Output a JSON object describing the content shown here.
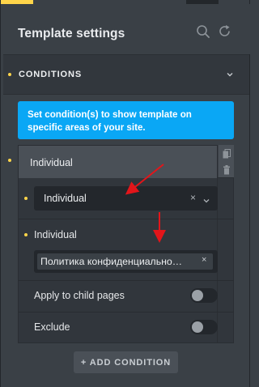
{
  "header": {
    "title": "Template settings",
    "search_icon": "search-icon",
    "refresh_icon": "refresh-icon"
  },
  "section": {
    "title": "CONDITIONS",
    "chevron_icon": "chevron-down-icon"
  },
  "info": {
    "text": "Set condition(s) to show template on specific areas of your site."
  },
  "condition": {
    "header_label": "Individual",
    "actions": [
      "copy-icon",
      "trash-icon"
    ],
    "type_select": {
      "value": "Individual",
      "clear": "×"
    },
    "individual_field": {
      "label": "Individual",
      "tag": "Политика конфиденциально…",
      "tag_remove": "×"
    },
    "apply_child": {
      "label": "Apply to child pages",
      "enabled": false
    },
    "exclude": {
      "label": "Exclude",
      "enabled": false
    }
  },
  "add_button": {
    "label": "+ ADD CONDITION"
  },
  "colors": {
    "accent_yellow": "#ffd54a",
    "info_blue": "#0aa7f5",
    "annotation_red": "#e3151a"
  }
}
